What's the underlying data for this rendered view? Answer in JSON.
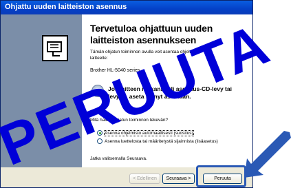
{
  "window": {
    "title": "Ohjattu uuden laitteiston asennus"
  },
  "wizard": {
    "heading": "Tervetuloa ohjattuun uuden laitteiston asennukseen",
    "intro": "Tämän ohjatun toiminnon avulla voit asentaa ohjelmisto laitteelle:",
    "device": "Brother HL-5040 series",
    "cd_prompt": "Jos laitteen mukana tuli asennus-CD-levy tai levyke, aseta se nyt asemaan.",
    "question": "Mitä haluat ohjatun toiminnon tekevän?",
    "options": [
      {
        "label": "Asenna ohjelmisto automaattisesti (suositus)",
        "selected": true
      },
      {
        "label": "Asenna luettelosta tai määritetystä sijainnista (lisäasetus)",
        "selected": false
      }
    ],
    "continue_text": "Jatka valitsemalla Seuraava."
  },
  "buttons": {
    "back": "< Edellinen",
    "next": "Seuraava >",
    "cancel": "Peruuta"
  },
  "overlay": {
    "watermark": "PERUUTA",
    "color": "#0000d8",
    "highlight_color": "#2a59b5"
  }
}
